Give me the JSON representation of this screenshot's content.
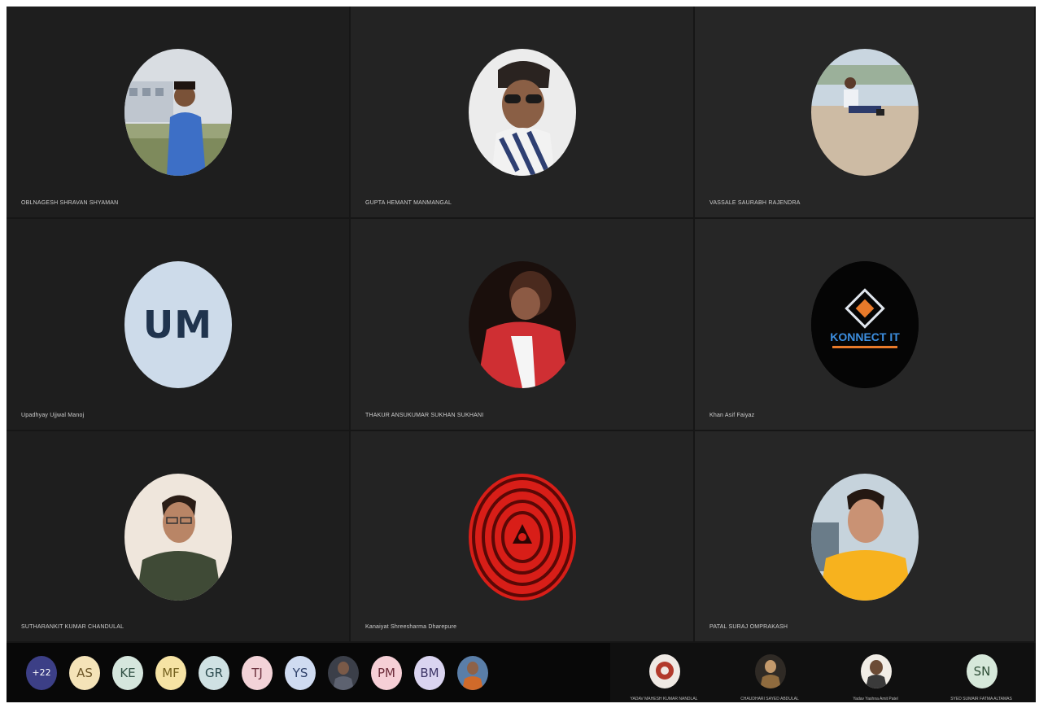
{
  "participants": [
    {
      "name": "OBLNAGESH SHRAVAN SHYAMAN",
      "kind": "photo",
      "tone": "outdoor-blue-shirt"
    },
    {
      "name": "GUPTA HEMANT MANMANGAL",
      "kind": "photo",
      "tone": "sunglasses"
    },
    {
      "name": "VASSALE SAURABH RAJENDRA",
      "kind": "photo",
      "tone": "beach-sitting"
    },
    {
      "name": "Upadhyay Ujjwal Manoj",
      "kind": "initials",
      "initials": "UM",
      "color": "#cddbea"
    },
    {
      "name": "THAKUR ANSUKUMAR SUKHAN SUKHANI",
      "kind": "photo",
      "tone": "red-jacket"
    },
    {
      "name": "Khan Asif Faiyaz",
      "kind": "logo",
      "logo_text": "KONNECT IT"
    },
    {
      "name": "SUTHARANKIT KUMAR CHANDULAL",
      "kind": "photo",
      "tone": "green-shirt"
    },
    {
      "name": "Kanaiyat Shreesharma Dharepure",
      "kind": "pattern",
      "tone": "red-rings"
    },
    {
      "name": "PATAL SURAJ OMPRAKASH",
      "kind": "photo",
      "tone": "yellow-shirt"
    }
  ],
  "roster": [
    {
      "label": "+22",
      "bg": "#3c3f86",
      "fg": "#ffffff",
      "kind": "count"
    },
    {
      "label": "AS",
      "bg": "#f4e3b8",
      "fg": "#6b5527",
      "kind": "initials"
    },
    {
      "label": "KE",
      "bg": "#d5e6dd",
      "fg": "#2f4f43",
      "kind": "initials"
    },
    {
      "label": "MF",
      "bg": "#f6e3a4",
      "fg": "#74611f",
      "kind": "initials"
    },
    {
      "label": "GR",
      "bg": "#cfe1e3",
      "fg": "#2b4a4e",
      "kind": "initials"
    },
    {
      "label": "TJ",
      "bg": "#f3d3d8",
      "fg": "#6a2f3c",
      "kind": "initials"
    },
    {
      "label": "YS",
      "bg": "#cfdbf1",
      "fg": "#2d3f68",
      "kind": "initials"
    },
    {
      "label": "",
      "kind": "photo"
    },
    {
      "label": "PM",
      "bg": "#f6cfd6",
      "fg": "#6d2b39",
      "kind": "initials"
    },
    {
      "label": "BM",
      "bg": "#dad4f0",
      "fg": "#3d3566",
      "kind": "initials"
    },
    {
      "label": "",
      "kind": "photo"
    }
  ],
  "mini_tiles": [
    {
      "name": "YADAV MAHESH KUMAR NANDLAL",
      "kind": "photo"
    },
    {
      "name": "CHAUDHARI SAYED ABDULAL",
      "kind": "photo"
    },
    {
      "name": "Yadav Yashna Amit Patel",
      "kind": "photo"
    },
    {
      "name": "SYED SUMAIR FATMA ALTAMAS",
      "kind": "initials",
      "initials": "SN",
      "bg": "#d6e8da",
      "fg": "#2d4d36"
    }
  ]
}
